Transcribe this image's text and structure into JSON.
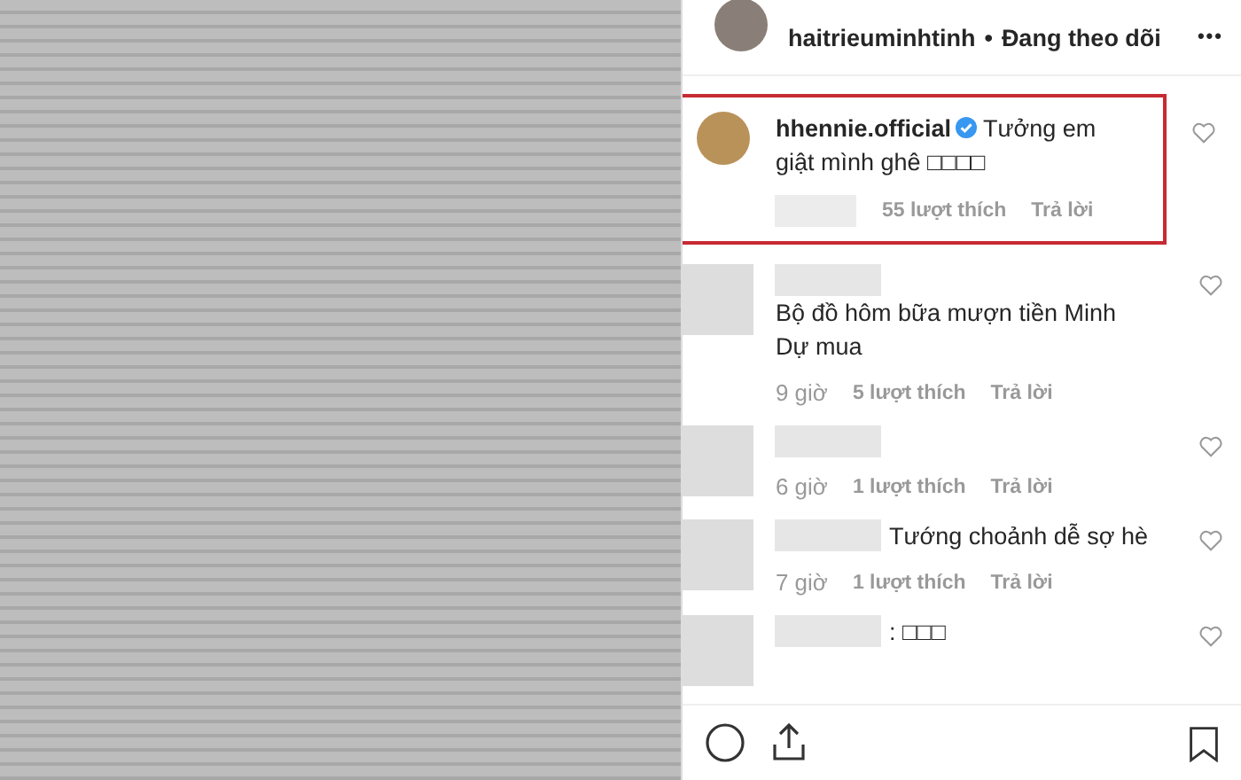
{
  "post_header": {
    "username": "haitrieuminhtinh",
    "separator": "•",
    "follow_status": "Đang theo dõi",
    "more": "•••"
  },
  "comments": [
    {
      "author": "hhennie.official",
      "verified": true,
      "text": "Tưởng em giật mình ghê □□□□",
      "likes": "55 lượt thích",
      "reply": "Trả lời",
      "highlighted": true,
      "kind": "photo"
    },
    {
      "text": "Bộ đồ hôm bữa mượn tiền Minh Dự mua",
      "time": "9 giờ",
      "likes": "5 lượt thích",
      "reply": "Trả lời",
      "highlighted": false,
      "verified": false,
      "kind": "blurred"
    },
    {
      "time": "6 giờ",
      "likes": "1 lượt thích",
      "reply": "Trả lời",
      "highlighted": false,
      "verified": false,
      "kind": "blurred"
    },
    {
      "text": "Tướng choảnh dễ sợ hè",
      "time": "7 giờ",
      "likes": "1 lượt thích",
      "reply": "Trả lời",
      "highlighted": false,
      "verified": false,
      "kind": "blurred"
    },
    {
      "text": ": □□□",
      "highlighted": false,
      "verified": false,
      "kind": "blurred"
    }
  ]
}
